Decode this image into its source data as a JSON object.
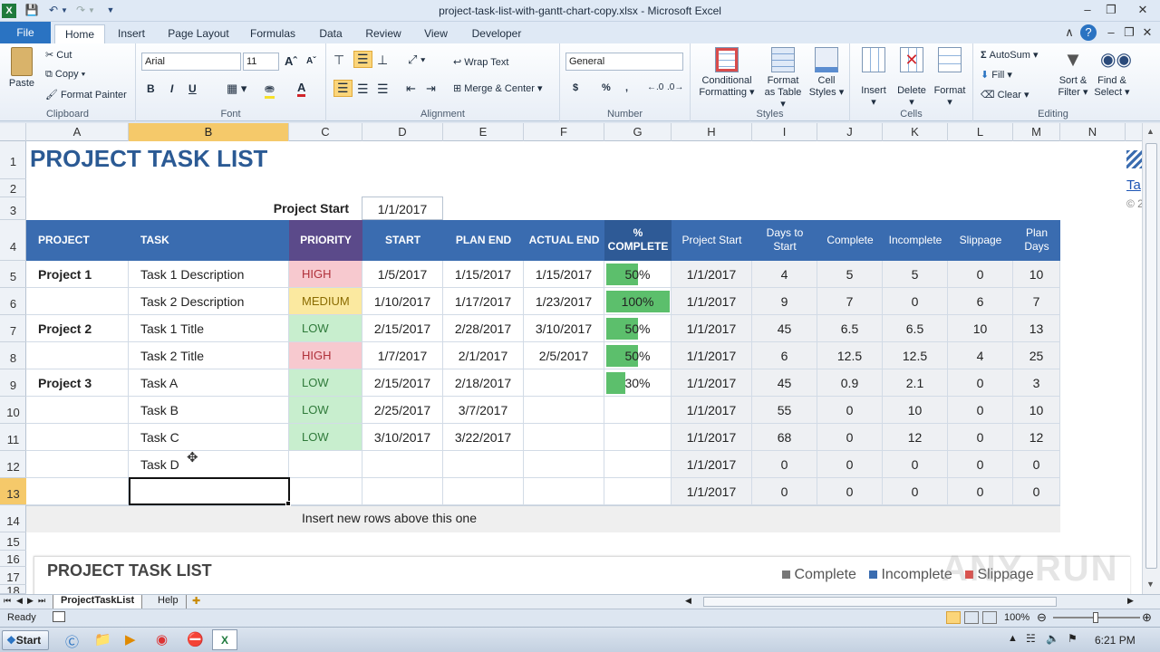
{
  "window": {
    "title": "project-task-list-with-gantt-chart-copy.xlsx  -  Microsoft Excel"
  },
  "tabs": [
    "File",
    "Home",
    "Insert",
    "Page Layout",
    "Formulas",
    "Data",
    "Review",
    "View",
    "Developer"
  ],
  "ribbon": {
    "clipboard": {
      "paste": "Paste",
      "cut": "Cut",
      "copy": "Copy",
      "format_painter": "Format Painter",
      "label": "Clipboard"
    },
    "font": {
      "name": "Arial",
      "size": "11",
      "label": "Font",
      "bold": "B",
      "italic": "I",
      "underline": "U"
    },
    "alignment": {
      "wrap": "Wrap Text",
      "merge": "Merge & Center",
      "label": "Alignment"
    },
    "number": {
      "format": "General",
      "currency": "$",
      "percent": "%",
      "comma": ",",
      "label": "Number"
    },
    "styles": {
      "conditional": "Conditional",
      "conditional2": "Formatting",
      "format_table": "Format",
      "format_table2": "as Table",
      "cell_styles": "Cell",
      "cell_styles2": "Styles",
      "label": "Styles"
    },
    "cells": {
      "insert": "Insert",
      "delete": "Delete",
      "format": "Format",
      "label": "Cells"
    },
    "editing": {
      "autosum": "AutoSum",
      "fill": "Fill",
      "clear": "Clear",
      "sort": "Sort &",
      "sort2": "Filter",
      "find": "Find &",
      "find2": "Select",
      "label": "Editing"
    }
  },
  "columns": [
    "A",
    "B",
    "C",
    "D",
    "E",
    "F",
    "G",
    "H",
    "I",
    "J",
    "K",
    "L",
    "M",
    "N"
  ],
  "rows": [
    "1",
    "2",
    "3",
    "4",
    "5",
    "6",
    "7",
    "8",
    "9",
    "10",
    "11",
    "12",
    "13",
    "14",
    "15",
    "16",
    "17",
    "18"
  ],
  "sheet": {
    "title": "PROJECT TASK LIST",
    "project_start_label": "Project Start",
    "project_start_value": "1/1/2017",
    "headers": {
      "project": "PROJECT",
      "task": "TASK",
      "priority": "PRIORITY",
      "start": "START",
      "plan_end": "PLAN END",
      "actual_end": "ACTUAL END",
      "complete1": "%",
      "complete2": "COMPLETE",
      "h_project_start": "Project Start",
      "days1": "Days to",
      "days2": "Start",
      "complete": "Complete",
      "incomplete": "Incomplete",
      "slippage": "Slippage",
      "plan1": "Plan",
      "plan2": "Days"
    },
    "table": [
      {
        "project": "Project 1",
        "task": "Task 1 Description",
        "priority": "HIGH",
        "start": "1/5/2017",
        "plan_end": "1/15/2017",
        "actual_end": "1/15/2017",
        "pct": "50%",
        "pct_value": 0.5,
        "ps": "1/1/2017",
        "days": "4",
        "comp": "5",
        "incomp": "5",
        "slip": "0",
        "plan": "10"
      },
      {
        "project": "",
        "task": "Task 2 Description",
        "priority": "MEDIUM",
        "start": "1/10/2017",
        "plan_end": "1/17/2017",
        "actual_end": "1/23/2017",
        "pct": "100%",
        "pct_value": 1.0,
        "ps": "1/1/2017",
        "days": "9",
        "comp": "7",
        "incomp": "0",
        "slip": "6",
        "plan": "7"
      },
      {
        "project": "Project 2",
        "task": "Task 1 Title",
        "priority": "LOW",
        "start": "2/15/2017",
        "plan_end": "2/28/2017",
        "actual_end": "3/10/2017",
        "pct": "50%",
        "pct_value": 0.5,
        "ps": "1/1/2017",
        "days": "45",
        "comp": "6.5",
        "incomp": "6.5",
        "slip": "10",
        "plan": "13"
      },
      {
        "project": "",
        "task": "Task 2 Title",
        "priority": "HIGH",
        "start": "1/7/2017",
        "plan_end": "2/1/2017",
        "actual_end": "2/5/2017",
        "pct": "50%",
        "pct_value": 0.5,
        "ps": "1/1/2017",
        "days": "6",
        "comp": "12.5",
        "incomp": "12.5",
        "slip": "4",
        "plan": "25"
      },
      {
        "project": "Project 3",
        "task": "Task A",
        "priority": "LOW",
        "start": "2/15/2017",
        "plan_end": "2/18/2017",
        "actual_end": "",
        "pct": "30%",
        "pct_value": 0.3,
        "ps": "1/1/2017",
        "days": "45",
        "comp": "0.9",
        "incomp": "2.1",
        "slip": "0",
        "plan": "3"
      },
      {
        "project": "",
        "task": "Task B",
        "priority": "LOW",
        "start": "2/25/2017",
        "plan_end": "3/7/2017",
        "actual_end": "",
        "pct": "",
        "pct_value": 0,
        "ps": "1/1/2017",
        "days": "55",
        "comp": "0",
        "incomp": "10",
        "slip": "0",
        "plan": "10"
      },
      {
        "project": "",
        "task": "Task C",
        "priority": "LOW",
        "start": "3/10/2017",
        "plan_end": "3/22/2017",
        "actual_end": "",
        "pct": "",
        "pct_value": 0,
        "ps": "1/1/2017",
        "days": "68",
        "comp": "0",
        "incomp": "12",
        "slip": "0",
        "plan": "12"
      },
      {
        "project": "",
        "task": "Task D",
        "priority": "",
        "start": "",
        "plan_end": "",
        "actual_end": "",
        "pct": "",
        "pct_value": 0,
        "ps": "1/1/2017",
        "days": "0",
        "comp": "0",
        "incomp": "0",
        "slip": "0",
        "plan": "0"
      },
      {
        "project": "",
        "task": "",
        "priority": "",
        "start": "",
        "plan_end": "",
        "actual_end": "",
        "pct": "",
        "pct_value": 0,
        "ps": "1/1/2017",
        "days": "0",
        "comp": "0",
        "incomp": "0",
        "slip": "0",
        "plan": "0"
      }
    ],
    "insert_note": "Insert new rows above this one",
    "chart_title": "PROJECT TASK LIST",
    "legend": [
      "Complete",
      "Incomplete",
      "Slippage"
    ],
    "side_text1": "Ta",
    "side_text2": "© 2"
  },
  "priority_colors": {
    "HIGH": "#f7c9cf",
    "MEDIUM": "#fbe9a0",
    "LOW": "#c8eece"
  },
  "priority_text_colors": {
    "HIGH": "#b0303a",
    "MEDIUM": "#8a6b00",
    "LOW": "#2f7a3a"
  },
  "sheet_tabs": [
    "ProjectTaskList",
    "Help"
  ],
  "status": {
    "ready": "Ready",
    "zoom": "100%"
  },
  "taskbar": {
    "start": "Start",
    "time": "6:21 PM"
  },
  "watermark": "ANY RUN"
}
